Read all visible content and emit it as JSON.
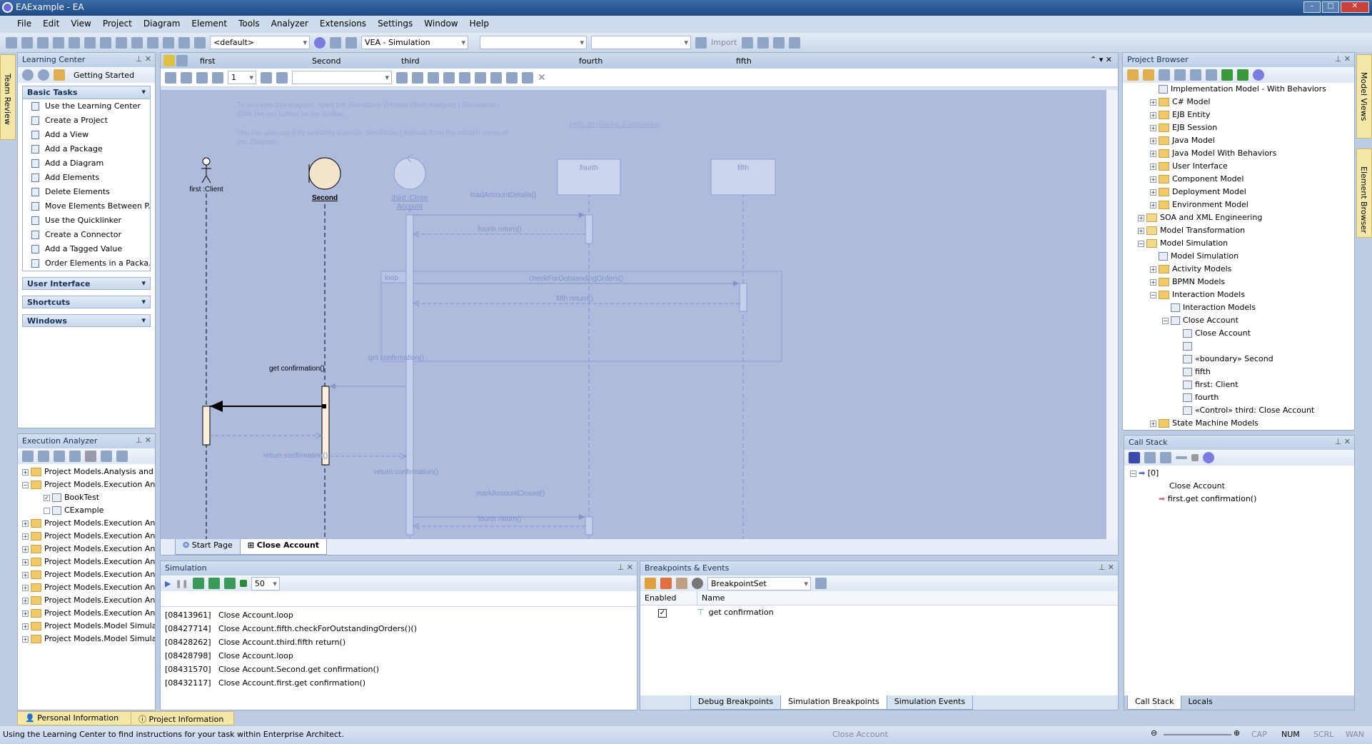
{
  "window": {
    "title": "EAExample - EA"
  },
  "menu": [
    "File",
    "Edit",
    "View",
    "Project",
    "Diagram",
    "Element",
    "Tools",
    "Analyzer",
    "Extensions",
    "Settings",
    "Window",
    "Help"
  ],
  "toolbar": {
    "workspace": "<default>",
    "perspective": "VEA - Simulation",
    "combo3": "",
    "combo4": "",
    "import_label": "Import"
  },
  "left_strip": {
    "label": "Team Review"
  },
  "right_strip": {
    "labels": [
      "Model Views",
      "Element Browser"
    ]
  },
  "learning_center": {
    "title": "Learning Center",
    "nav_combo": "Getting Started",
    "basic_tasks_header": "Basic Tasks",
    "tasks": [
      "Use the Learning Center",
      "Create a Project",
      "Add a View",
      "Add a Package",
      "Add a Diagram",
      "Add Elements",
      "Delete Elements",
      "Move Elements Between P...",
      "Use the Quicklinker",
      "Create a Connector",
      "Add a Tagged Value",
      "Order Elements in a Packa..."
    ],
    "sections": [
      "User Interface",
      "Shortcuts",
      "Windows"
    ]
  },
  "execution_analyzer": {
    "title": "Execution Analyzer",
    "items": [
      {
        "label": "Project Models.Analysis and I",
        "level": 0,
        "expander": "+"
      },
      {
        "label": "Project Models.Execution Ana",
        "level": 0,
        "expander": "-"
      },
      {
        "label": "BookTest",
        "level": 1,
        "checked": true
      },
      {
        "label": "CExample",
        "level": 1,
        "checked": false
      },
      {
        "label": "Project Models.Execution Ana",
        "level": 0,
        "expander": "+"
      },
      {
        "label": "Project Models.Execution Ana",
        "level": 0,
        "expander": "+"
      },
      {
        "label": "Project Models.Execution Ana",
        "level": 0,
        "expander": "+"
      },
      {
        "label": "Project Models.Execution Ana",
        "level": 0,
        "expander": "+"
      },
      {
        "label": "Project Models.Execution Ana",
        "level": 0,
        "expander": "+"
      },
      {
        "label": "Project Models.Execution Ana",
        "level": 0,
        "expander": "+"
      },
      {
        "label": "Project Models.Execution Ana",
        "level": 0,
        "expander": "+"
      },
      {
        "label": "Project Models.Execution Ana",
        "level": 0,
        "expander": "+"
      },
      {
        "label": "Project Models.Model Simula",
        "level": 0,
        "expander": "+"
      },
      {
        "label": "Project Models.Model Simula",
        "level": 0,
        "expander": "+"
      }
    ]
  },
  "diagram": {
    "lifeline_header": [
      "first",
      "Second",
      "third",
      "fourth",
      "fifth"
    ],
    "help_text": [
      "To simulate this diagram, open the Simulation Window (from Analyzer | Simulation.)",
      "Click the run button on the toolbar.",
      "You can also run it by selecting Execute Simulation | Manual from the context menu of",
      "this Diagram."
    ],
    "help_link": "Help on running a simulation",
    "lifelines": {
      "first": "first :Client",
      "second": "Second",
      "third1": "third :Close",
      "third2": "Account",
      "fourth": "fourth",
      "fifth": "fifth"
    },
    "fragment": "loop",
    "messages": [
      "loadAccountDetails()",
      "fourth return()",
      "checkForOutstandingOrders()",
      "fifth return()",
      "get confirmation()",
      "get confirmation()",
      "return confirmation()",
      "return confirmation()",
      "markAccountClosed()",
      "fourth return()"
    ],
    "tabs": [
      "Start Page",
      "Close Account"
    ],
    "active_tab": "Close Account",
    "colors": {
      "canvas": "#aebbdc",
      "active": "#000000",
      "faded": "#7f93c9"
    }
  },
  "simulation": {
    "title": "Simulation",
    "speed": "50",
    "log": [
      [
        "[08413961]",
        "Close Account.loop"
      ],
      [
        "[08427714]",
        "Close Account.fifth.checkForOutstandingOrders()()"
      ],
      [
        "[08428262]",
        "Close Account.third.fifth return()"
      ],
      [
        "[08428798]",
        "Close Account.loop"
      ],
      [
        "[08431570]",
        "Close Account.Second.get confirmation()"
      ],
      [
        "[08432117]",
        "Close Account.first.get confirmation()"
      ]
    ]
  },
  "breakpoints": {
    "title": "Breakpoints & Events",
    "set_combo": "BreakpointSet",
    "columns": [
      "Enabled",
      "Name"
    ],
    "rows": [
      {
        "enabled": true,
        "name": "get confirmation"
      }
    ],
    "tabs": [
      "Debug Breakpoints",
      "Simulation Breakpoints",
      "Simulation Events"
    ],
    "active_tab": "Simulation Breakpoints"
  },
  "project_browser": {
    "title": "Project Browser",
    "items": [
      {
        "label": "Implementation Model - With Behaviors",
        "level": 2,
        "icon": "diagram",
        "expander": ""
      },
      {
        "label": "C# Model",
        "level": 2,
        "icon": "folder",
        "expander": "+"
      },
      {
        "label": "EJB Entity",
        "level": 2,
        "icon": "folder",
        "expander": "+"
      },
      {
        "label": "EJB Session",
        "level": 2,
        "icon": "folder",
        "expander": "+"
      },
      {
        "label": "Java Model",
        "level": 2,
        "icon": "folder",
        "expander": "+"
      },
      {
        "label": "Java Model With Behaviors",
        "level": 2,
        "icon": "folder",
        "expander": "+"
      },
      {
        "label": "User Interface",
        "level": 2,
        "icon": "folder",
        "expander": "+"
      },
      {
        "label": "Component Model",
        "level": 2,
        "icon": "folder",
        "expander": "+"
      },
      {
        "label": "Deployment Model",
        "level": 2,
        "icon": "folder",
        "expander": "+"
      },
      {
        "label": "Environment Model",
        "level": 2,
        "icon": "folder",
        "expander": "+"
      },
      {
        "label": "SOA and XML Engineering",
        "level": 1,
        "icon": "package",
        "expander": "+"
      },
      {
        "label": "Model Transformation",
        "level": 1,
        "icon": "package",
        "expander": "+"
      },
      {
        "label": "Model Simulation",
        "level": 1,
        "icon": "package",
        "expander": "-"
      },
      {
        "label": "Model Simulation",
        "level": 2,
        "icon": "diagram",
        "expander": ""
      },
      {
        "label": "Activity Models",
        "level": 2,
        "icon": "folder",
        "expander": "+"
      },
      {
        "label": "BPMN Models",
        "level": 2,
        "icon": "folder",
        "expander": "+"
      },
      {
        "label": "Interaction Models",
        "level": 2,
        "icon": "folder",
        "expander": "-"
      },
      {
        "label": "Interaction Models",
        "level": 3,
        "icon": "diagram",
        "expander": ""
      },
      {
        "label": "Close Account",
        "level": 3,
        "icon": "interaction",
        "expander": "-"
      },
      {
        "label": "Close Account",
        "level": 4,
        "icon": "diagram",
        "expander": ""
      },
      {
        "label": "",
        "level": 4,
        "icon": "element",
        "expander": ""
      },
      {
        "label": "«boundary» Second",
        "level": 4,
        "icon": "element",
        "expander": ""
      },
      {
        "label": "fifth",
        "level": 4,
        "icon": "element",
        "expander": ""
      },
      {
        "label": "first: Client",
        "level": 4,
        "icon": "element",
        "expander": ""
      },
      {
        "label": "fourth",
        "level": 4,
        "icon": "element",
        "expander": ""
      },
      {
        "label": "«Control» third: Close Account",
        "level": 4,
        "icon": "element",
        "expander": ""
      },
      {
        "label": "State Machine Models",
        "level": 2,
        "icon": "folder",
        "expander": "+"
      }
    ]
  },
  "call_stack": {
    "title": "Call Stack",
    "frame": "[0]",
    "entries": [
      "Close Account",
      "first.get confirmation()"
    ],
    "tabs": [
      "Call Stack",
      "Locals"
    ]
  },
  "bottom_tabs": [
    "Personal Information",
    "Project Information"
  ],
  "status": {
    "message": "Using the Learning Center to find instructions for your task within Enterprise Architect.",
    "context": "Close Account",
    "indicators": [
      "CAP",
      "NUM",
      "SCRL",
      "WAN"
    ],
    "active_indicator": "NUM"
  }
}
